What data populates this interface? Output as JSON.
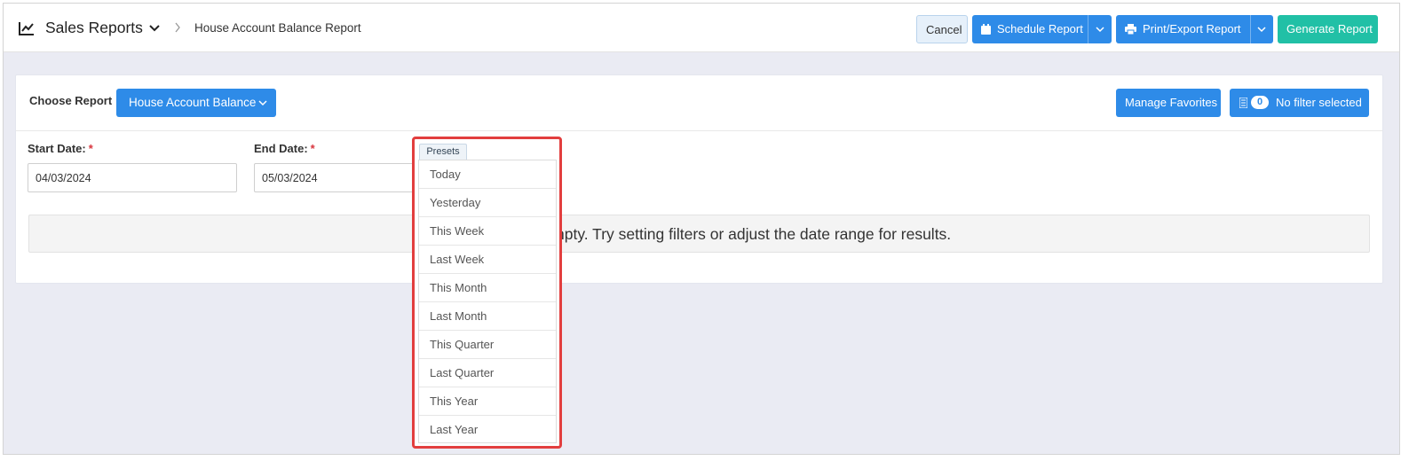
{
  "header": {
    "app_title": "Sales Reports",
    "breadcrumb_current": "House Account Balance Report",
    "cancel_label": "Cancel",
    "schedule_label": "Schedule Report",
    "print_label": "Print/Export Report",
    "generate_label": "Generate Report",
    "icons": [
      "line-chart-icon",
      "chevron-down-icon",
      "chevron-right-icon",
      "calendar-icon",
      "printer-icon"
    ]
  },
  "report": {
    "choose_label": "Choose Report",
    "selected_report": "House Account Balance",
    "manage_favorites_label": "Manage Favorites",
    "filter_count": "0",
    "filter_label": "No filter selected"
  },
  "dates": {
    "start_label": "Start Date:",
    "start_value": "04/03/2024",
    "end_label": "End Date:",
    "end_value": "05/03/2024",
    "required_mark": "*"
  },
  "empty_message": "npty. Try setting filters or adjust the date range for results.",
  "presets": {
    "tab_label": "Presets",
    "items": [
      "Today",
      "Yesterday",
      "This Week",
      "Last Week",
      "This Month",
      "Last Month",
      "This Quarter",
      "Last Quarter",
      "This Year",
      "Last Year"
    ]
  },
  "colors": {
    "primary": "#2e8be8",
    "accent": "#21c0a6",
    "highlight": "#e23e3e",
    "background": "#eaebf3"
  }
}
